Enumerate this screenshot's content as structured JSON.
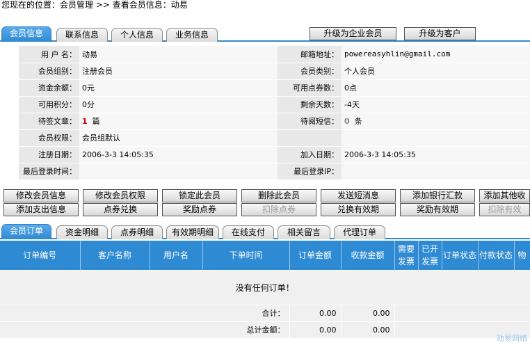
{
  "breadcrumb": "您现在的位置：会员管理 >> 查看会员信息：动易",
  "top_tabs": [
    "会员信息",
    "联系信息",
    "个人信息",
    "业务信息"
  ],
  "top_buttons": [
    "升级为企业会员",
    "升级为客户"
  ],
  "info_rows": [
    {
      "l1": "用 户 名：",
      "v1": "动易",
      "l2": "邮箱地址：",
      "v2": "powereasyhlin@gmail.com"
    },
    {
      "l1": "会员组别：",
      "v1": "注册会员",
      "l2": "会员类别：",
      "v2": "个人会员"
    },
    {
      "l1": "资金余额：",
      "v1": "0元",
      "l2": "可用点券数：",
      "v2": "0点"
    },
    {
      "l1": "可用积分：",
      "v1": "0分",
      "l2": "剩余天数：",
      "v2": "-4天"
    },
    {
      "l1": "待签文章：",
      "v1_num": "1",
      "v1_unit": "篇",
      "l2": "待阅短信：",
      "v2_num": "0",
      "v2_unit": "条"
    },
    {
      "l1": "会员权限：",
      "v1": "会员组默认",
      "l2": "",
      "v2": ""
    },
    {
      "l1": "注册日期：",
      "v1": "2006-3-3 14:05:35",
      "l2": "加入日期：",
      "v2": "2006-3-3 14:05:35"
    },
    {
      "l1": "最后登录时间：",
      "v1": "",
      "l2": "最后登录IP：",
      "v2": ""
    }
  ],
  "action_buttons_row1": [
    "修改会员信息",
    "修改会员权限",
    "锁定此会员",
    "删除此会员",
    "发送短消息",
    "添加银行汇款",
    "添加其他收"
  ],
  "action_buttons_row2": [
    "添加支出信息",
    "点券兑换",
    "奖励点券",
    "扣除点券",
    "兑换有效期",
    "奖励有效期",
    "扣除有效"
  ],
  "bottom_tabs": [
    "会员订单",
    "资金明细",
    "点券明细",
    "有效期明细",
    "在线支付",
    "相关留言",
    "代理订单"
  ],
  "grid": {
    "headers": [
      "订单编号",
      "客户名称",
      "用户名",
      "下单时间",
      "订单金额",
      "收款金额",
      "需要发票",
      "已开发票",
      "订单状态",
      "付款状态",
      "物"
    ],
    "empty_text": "没有任何订单！",
    "subtotal_label": "合计：",
    "subtotal_order": "0.00",
    "subtotal_received": "0.00",
    "total_label": "总计金额：",
    "total_order": "0.00",
    "total_received": "0.00"
  },
  "watermark": "动易网络",
  "colors": {
    "accent": "#2e8ad3",
    "warn": "#c00000"
  }
}
